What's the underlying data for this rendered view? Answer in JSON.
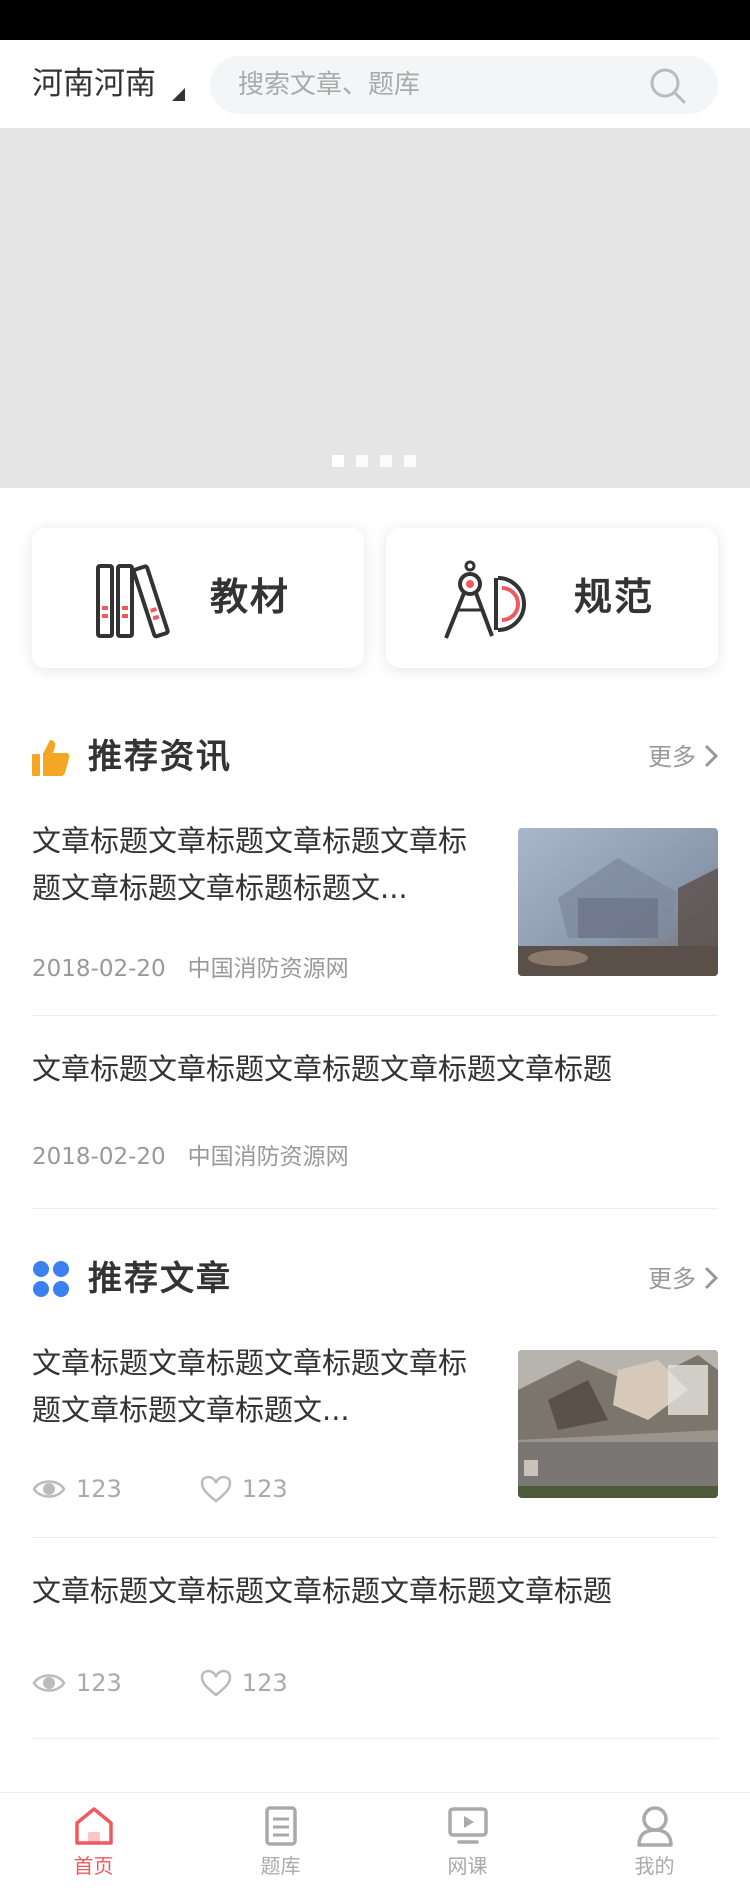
{
  "header": {
    "city": "河南河南",
    "search_placeholder": "搜索文章、题库"
  },
  "banner": {
    "slide_count": 4,
    "active_index": 0
  },
  "categories": [
    {
      "label": "教材",
      "icon": "books-icon"
    },
    {
      "label": "规范",
      "icon": "compass-ruler-icon"
    }
  ],
  "news_section": {
    "title": "推荐资讯",
    "more": "更多",
    "icon": "thumbs-up-icon",
    "items": [
      {
        "title": "文章标题文章标题文章标题文章标题文章标题文章标题标题文...",
        "date": "2018-02-20",
        "source": "中国消防资源网",
        "has_thumb": true
      },
      {
        "title": "文章标题文章标题文章标题文章标题文章标题",
        "date": "2018-02-20",
        "source": "中国消防资源网",
        "has_thumb": false
      }
    ]
  },
  "articles_section": {
    "title": "推荐文章",
    "more": "更多",
    "icon": "grid-icon",
    "items": [
      {
        "title": "文章标题文章标题文章标题文章标题文章标题文章标题文...",
        "views": "123",
        "likes": "123",
        "has_thumb": true
      },
      {
        "title": "文章标题文章标题文章标题文章标题文章标题",
        "views": "123",
        "likes": "123",
        "has_thumb": false
      }
    ]
  },
  "tabbar": [
    {
      "label": "首页",
      "icon": "home-icon",
      "active": true
    },
    {
      "label": "题库",
      "icon": "book-icon",
      "active": false
    },
    {
      "label": "网课",
      "icon": "video-icon",
      "active": false
    },
    {
      "label": "我的",
      "icon": "user-icon",
      "active": false
    }
  ],
  "colors": {
    "accent": "#ee5a5f",
    "thumbs_up": "#f5a623",
    "grid_blue": "#3b7ff0",
    "muted_text": "#999999"
  }
}
